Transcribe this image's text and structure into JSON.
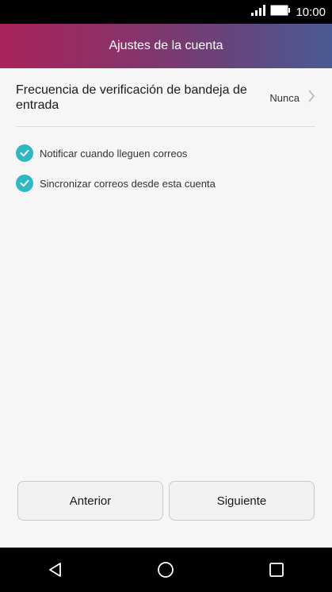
{
  "status_bar": {
    "time": "10:00",
    "signal_icon": "signal-icon",
    "battery_icon": "battery-icon"
  },
  "header": {
    "title": "Ajustes de la cuenta"
  },
  "settings": {
    "frequency": {
      "label": "Frecuencia de verificación de bandeja de entrada",
      "value": "Nunca"
    },
    "options": [
      {
        "label": "Notificar cuando lleguen correos",
        "checked": true
      },
      {
        "label": "Sincronizar correos desde esta cuenta",
        "checked": true
      }
    ]
  },
  "buttons": {
    "previous": "Anterior",
    "next": "Siguiente"
  },
  "nav_bar": {
    "back": "back-icon",
    "home": "home-icon",
    "recents": "recents-icon"
  },
  "colors": {
    "accent": "#2fb8c3",
    "header_start": "#a8235a",
    "header_end": "#4a5a94"
  }
}
